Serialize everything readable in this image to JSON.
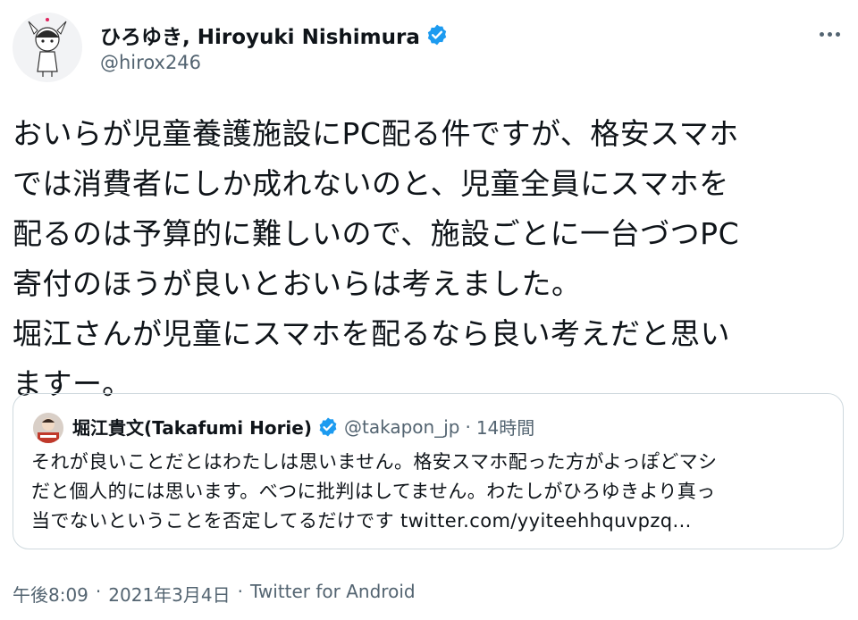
{
  "author": {
    "display_name": "ひろゆき, Hiroyuki Nishimura",
    "handle": "@hirox246",
    "verified_icon": "verified-badge-icon"
  },
  "tweet": {
    "lines": [
      "おいらが児童養護施設にPC配る件ですが、格安スマホ",
      "では消費者にしか成れないのと、児童全員にスマホを",
      "配るのは予算的に難しいので、施設ごとに一台づつPC",
      "寄付のほうが良いとおいらは考えました。",
      "堀江さんが児童にスマホを配るなら良い考えだと思い",
      "ますー。"
    ]
  },
  "quoted": {
    "display_name": "堀江貴文(Takafumi Horie)",
    "handle": "@takapon_jp",
    "separator": "·",
    "time": "14時間",
    "lines": [
      "それが良いことだとはわたしは思いません。格安スマホ配った方がよっぽどマシ",
      "だと個人的には思います。べつに批判はしてません。わたしがひろゆきより真っ"
    ],
    "last_line_text": "当でないということを否定してるだけです ",
    "link": "twitter.com/yyiteehhquvpzq..."
  },
  "meta": {
    "time": "午後8:09",
    "sep1": "·",
    "date": "2021年3月4日",
    "sep2": "·",
    "source": "Twitter for Android"
  },
  "colors": {
    "verified": "#1d9bf0",
    "secondary_text": "#536471",
    "border": "#cfd9de"
  }
}
